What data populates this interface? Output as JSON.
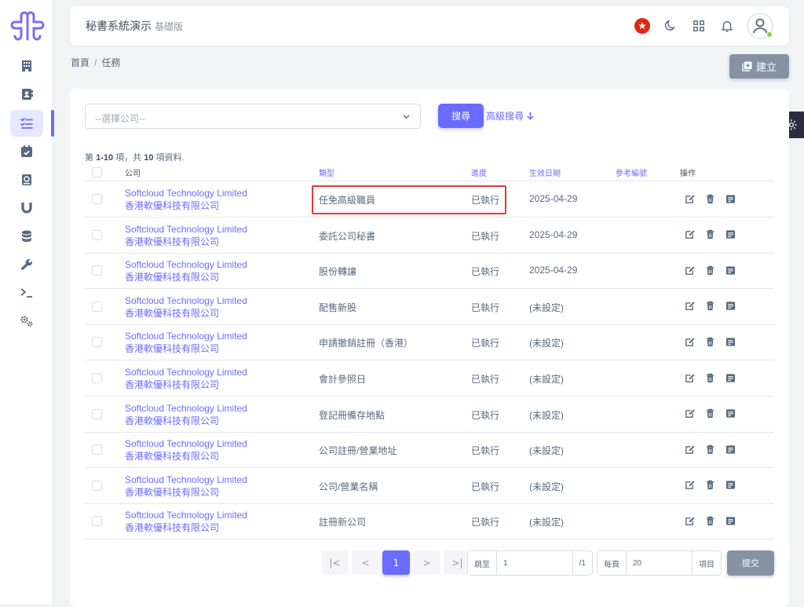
{
  "app": {
    "title": "秘書系統演示",
    "edition": "基礎版"
  },
  "colors": {
    "primary": "#696cff",
    "secondary": "#8592a3",
    "danger": "#e53935"
  },
  "sidebar": {
    "items": [
      {
        "icon": "building-icon"
      },
      {
        "icon": "address-book-icon"
      },
      {
        "icon": "task-list-icon",
        "active": true
      },
      {
        "icon": "calendar-check-icon"
      },
      {
        "icon": "mail-book-icon"
      },
      {
        "icon": "magnet-icon"
      },
      {
        "icon": "database-icon"
      },
      {
        "icon": "wrench-icon"
      },
      {
        "icon": "terminal-icon"
      },
      {
        "icon": "cogs-icon"
      }
    ]
  },
  "topbar": {
    "icons": [
      "hk-flag-icon",
      "moon-icon",
      "grid-icon",
      "bell-icon",
      "user-avatar-icon"
    ]
  },
  "breadcrumb": {
    "home": "首頁",
    "sep": "/",
    "current": "任務"
  },
  "create_button": {
    "label": "建立"
  },
  "filter": {
    "placeholder": "--選擇公司--",
    "search_label": "搜尋",
    "advanced_label": "高級搜尋"
  },
  "summary": {
    "prefix": "第",
    "range": "1-10",
    "mid1": "項，共",
    "total": "10",
    "mid2": "項資料."
  },
  "table": {
    "headers": {
      "company": "公司",
      "type": "類型",
      "progress": "進度",
      "date": "生效日期",
      "ref": "參考編號",
      "actions": "操作"
    },
    "rows": [
      {
        "company_en": "Softcloud Technology Limited",
        "company_zh": "香港軟優科技有限公司",
        "type": "任免高級職員",
        "progress": "已執行",
        "date": "2025-04-29"
      },
      {
        "company_en": "Softcloud Technology Limited",
        "company_zh": "香港軟優科技有限公司",
        "type": "委託公司秘書",
        "progress": "已執行",
        "date": "2025-04-29"
      },
      {
        "company_en": "Softcloud Technology Limited",
        "company_zh": "香港軟優科技有限公司",
        "type": "股份轉讓",
        "progress": "已執行",
        "date": "2025-04-29"
      },
      {
        "company_en": "Softcloud Technology Limited",
        "company_zh": "香港軟優科技有限公司",
        "type": "配售新股",
        "progress": "已執行",
        "date": "(未設定)"
      },
      {
        "company_en": "Softcloud Technology Limited",
        "company_zh": "香港軟優科技有限公司",
        "type": "申請撤銷註冊（香港）",
        "progress": "已執行",
        "date": "(未設定)"
      },
      {
        "company_en": "Softcloud Technology Limited",
        "company_zh": "香港軟優科技有限公司",
        "type": "會計參照日",
        "progress": "已執行",
        "date": "(未設定)"
      },
      {
        "company_en": "Softcloud Technology Limited",
        "company_zh": "香港軟優科技有限公司",
        "type": "登記冊備存地點",
        "progress": "已執行",
        "date": "(未設定)"
      },
      {
        "company_en": "Softcloud Technology Limited",
        "company_zh": "香港軟優科技有限公司",
        "type": "公司註冊/營業地址",
        "progress": "已執行",
        "date": "(未設定)"
      },
      {
        "company_en": "Softcloud Technology Limited",
        "company_zh": "香港軟優科技有限公司",
        "type": "公司/營業名稱",
        "progress": "已執行",
        "date": "(未設定)"
      },
      {
        "company_en": "Softcloud Technology Limited",
        "company_zh": "香港軟優科技有限公司",
        "type": "註冊新公司",
        "progress": "已執行",
        "date": "(未設定)"
      }
    ]
  },
  "pagination": {
    "first": "|<",
    "prev": "<",
    "current": "1",
    "next": ">",
    "last": ">|",
    "goto_label": "跳至",
    "goto_value": "1",
    "goto_suffix": "/1",
    "per_page_label": "每頁",
    "per_page_value": "20",
    "per_page_suffix": "項目",
    "submit_label": "提交"
  }
}
